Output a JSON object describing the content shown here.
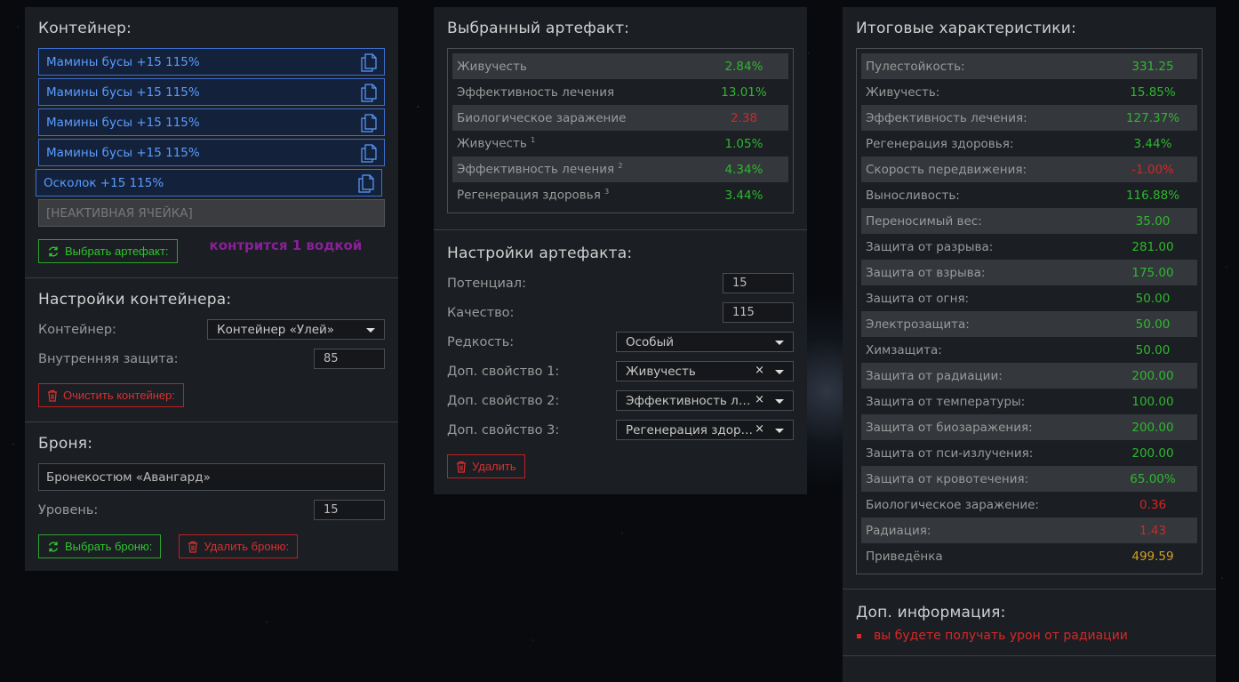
{
  "container": {
    "title": "Контейнер:",
    "slots": [
      "Мамины бусы +15 115%",
      "Мамины бусы +15 115%",
      "Мамины бусы +15 115%",
      "Мамины бусы +15 115%",
      "Осколок +15 115%"
    ],
    "inactive_slot": "[НЕАКТИВНАЯ ЯЧЕЙКА]",
    "select_artifact_button": "Выбрать артефакт:",
    "note": "контрится 1 водкой",
    "note_color": "#8a1f9a"
  },
  "container_settings": {
    "title": "Настройки контейнера:",
    "container_label": "Контейнер:",
    "container_value": "Контейнер «Улей»",
    "internal_protection_label": "Внутренняя защита:",
    "internal_protection_value": "85",
    "clear_button": "Очистить контейнер:"
  },
  "armor": {
    "title": "Броня:",
    "armor_value": "Бронекостюм «Авангард»",
    "level_label": "Уровень:",
    "level_value": "15",
    "select_button": "Выбрать броню:",
    "delete_button": "Удалить броню:"
  },
  "selected_artifact": {
    "title": "Выбранный артефакт:",
    "stats": [
      {
        "label": "Живучесть",
        "sup": "",
        "value": "2.84%",
        "color": "green"
      },
      {
        "label": "Эффективность лечения",
        "sup": "",
        "value": "13.01%",
        "color": "green"
      },
      {
        "label": "Биологическое заражение",
        "sup": "",
        "value": "2.38",
        "color": "red"
      },
      {
        "label": "Живучесть",
        "sup": "1",
        "value": "1.05%",
        "color": "green"
      },
      {
        "label": "Эффективность лечения",
        "sup": "2",
        "value": "4.34%",
        "color": "green"
      },
      {
        "label": "Регенерация здоровья",
        "sup": "3",
        "value": "3.44%",
        "color": "green"
      }
    ]
  },
  "artifact_settings": {
    "title": "Настройки артефакта:",
    "potential_label": "Потенциал:",
    "potential_value": "15",
    "quality_label": "Качество:",
    "quality_value": "115",
    "rarity_label": "Редкость:",
    "rarity_value": "Особый",
    "extra1_label": "Доп. свойство 1:",
    "extra1_value": "Живучесть",
    "extra2_label": "Доп. свойство 2:",
    "extra2_value": "Эффективность лечения",
    "extra3_label": "Доп. свойство 3:",
    "extra3_value": "Регенерация здоровья",
    "delete_button": "Удалить"
  },
  "totals": {
    "title": "Итоговые характеристики:",
    "stats": [
      {
        "label": "Пулестойкость:",
        "value": "331.25",
        "color": "green"
      },
      {
        "label": "Живучесть:",
        "value": "15.85%",
        "color": "green"
      },
      {
        "label": "Эффективность лечения:",
        "value": "127.37%",
        "color": "green"
      },
      {
        "label": "Регенерация здоровья:",
        "value": "3.44%",
        "color": "green"
      },
      {
        "label": "Скорость передвижения:",
        "value": "-1.00%",
        "color": "red"
      },
      {
        "label": "Выносливость:",
        "value": "116.88%",
        "color": "green"
      },
      {
        "label": "Переносимый вес:",
        "value": "35.00",
        "color": "green"
      },
      {
        "label": "Защита от разрыва:",
        "value": "281.00",
        "color": "green"
      },
      {
        "label": "Защита от взрыва:",
        "value": "175.00",
        "color": "green"
      },
      {
        "label": "Защита от огня:",
        "value": "50.00",
        "color": "green"
      },
      {
        "label": "Электрозащита:",
        "value": "50.00",
        "color": "green"
      },
      {
        "label": "Химзащита:",
        "value": "50.00",
        "color": "green"
      },
      {
        "label": "Защита от радиации:",
        "value": "200.00",
        "color": "green"
      },
      {
        "label": "Защита от температуры:",
        "value": "100.00",
        "color": "green"
      },
      {
        "label": "Защита от биозаражения:",
        "value": "200.00",
        "color": "green"
      },
      {
        "label": "Защита от пси-излучения:",
        "value": "200.00",
        "color": "green"
      },
      {
        "label": "Защита от кровотечения:",
        "value": "65.00%",
        "color": "green"
      },
      {
        "label": "Биологическое заражение:",
        "value": "0.36",
        "color": "red"
      },
      {
        "label": "Радиация:",
        "value": "1.43",
        "color": "red"
      },
      {
        "label": "Приведёнка",
        "value": "499.59",
        "color": "yellow"
      }
    ]
  },
  "extra_info": {
    "title": "Доп. информация:",
    "items": [
      "вы будете получать урон от радиации"
    ]
  },
  "colors": {
    "green": "#2eb82e",
    "red": "#d02828",
    "yellow": "#d4a020",
    "blue_slot": "#5a9cff",
    "panel_bg": "#1b1e23"
  },
  "icons": {
    "copy": "copy-icon",
    "refresh": "refresh-icon",
    "trash": "trash-icon",
    "caret": "chevron-down-icon",
    "clear": "clear-icon"
  }
}
